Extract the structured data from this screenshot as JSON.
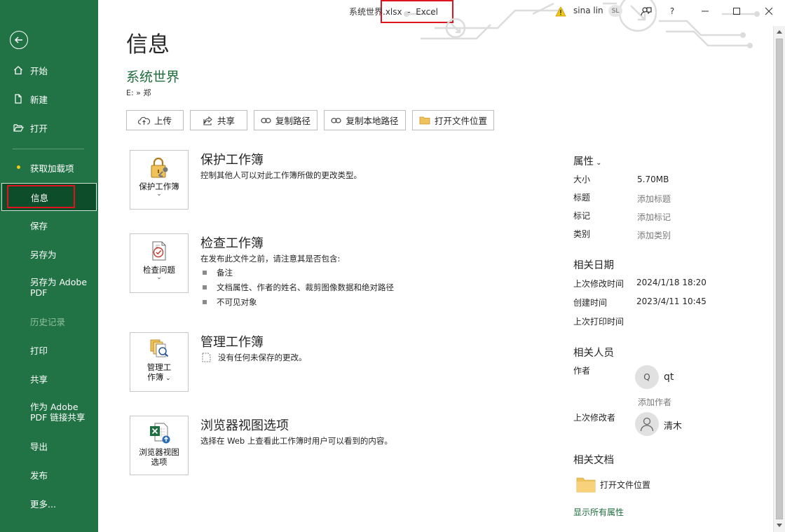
{
  "titlebar": {
    "title": "系统世界.xlsx  -  Excel",
    "user_name": "sina lin",
    "user_initials": "SL",
    "help_label": "?"
  },
  "sidebar": {
    "items": [
      {
        "label": "开始",
        "icon": "home-icon"
      },
      {
        "label": "新建",
        "icon": "new-file-icon"
      },
      {
        "label": "打开",
        "icon": "folder-open-icon"
      },
      {
        "label": "获取加载项",
        "icon": "dot-icon"
      },
      {
        "label": "信息",
        "selected": true
      },
      {
        "label": "保存"
      },
      {
        "label": "另存为"
      },
      {
        "label_line1": "另存为 Adobe",
        "label_line2": "PDF"
      },
      {
        "label": "历史记录",
        "disabled": true
      },
      {
        "label": "打印"
      },
      {
        "label": "共享"
      },
      {
        "label_line1": "作为 Adobe",
        "label_line2": "PDF 链接共享"
      },
      {
        "label": "导出"
      },
      {
        "label": "发布"
      },
      {
        "label": "更多..."
      }
    ]
  },
  "main": {
    "page_title": "信息",
    "file_name": "系统世界",
    "file_path": "E: » 郑",
    "actions": [
      {
        "label": "上传",
        "icon": "cloud-upload-icon"
      },
      {
        "label": "共享",
        "icon": "share-icon"
      },
      {
        "label": "复制路径",
        "icon": "link-icon"
      },
      {
        "label": "复制本地路径",
        "icon": "link-icon"
      },
      {
        "label": "打开文件位置",
        "icon": "folder-icon"
      }
    ],
    "sections": [
      {
        "button_label": "保护工作簿",
        "title": "保护工作簿",
        "desc": "控制其他人可以对此工作簿所做的更改类型。"
      },
      {
        "button_label": "检查问题",
        "title": "检查工作簿",
        "desc": "在发布此文件之前，请注意其是否包含:",
        "bullets": [
          "备注",
          "文档属性、作者的姓名、裁剪图像数据和绝对路径",
          "不可见对象"
        ]
      },
      {
        "button_label_line1": "管理工",
        "button_label_line2": "作簿",
        "title": "管理工作簿",
        "desc": "没有任何未保存的更改。"
      },
      {
        "button_label_line1": "浏览器视图",
        "button_label_line2": "选项",
        "title": "浏览器视图选项",
        "desc": "选择在 Web 上查看此工作簿时用户可以看到的内容。"
      }
    ]
  },
  "properties": {
    "header": "属性",
    "rows": [
      {
        "label": "大小",
        "value": "5.70MB",
        "is_link": false
      },
      {
        "label": "标题",
        "value": "添加标题",
        "is_link": true
      },
      {
        "label": "标记",
        "value": "添加标记",
        "is_link": true
      },
      {
        "label": "类别",
        "value": "添加类别",
        "is_link": true
      }
    ],
    "dates_header": "相关日期",
    "dates": [
      {
        "label": "上次修改时间",
        "value": "2024/1/18 18:20"
      },
      {
        "label": "创建时间",
        "value": "2023/4/11 10:45"
      },
      {
        "label": "上次打印时间",
        "value": ""
      }
    ],
    "people_header": "相关人员",
    "author_label": "作者",
    "author_initial": "Q",
    "author_name": "qt",
    "add_author": "添加作者",
    "modifier_label": "上次修改者",
    "modifier_name": "清木",
    "docs_header": "相关文档",
    "open_location": "打开文件位置",
    "show_all": "显示所有属性"
  },
  "colors": {
    "accent": "#217346",
    "selected_bg": "#0e4d2a",
    "highlight": "#e0141e",
    "link_green": "#1e6b3c"
  }
}
